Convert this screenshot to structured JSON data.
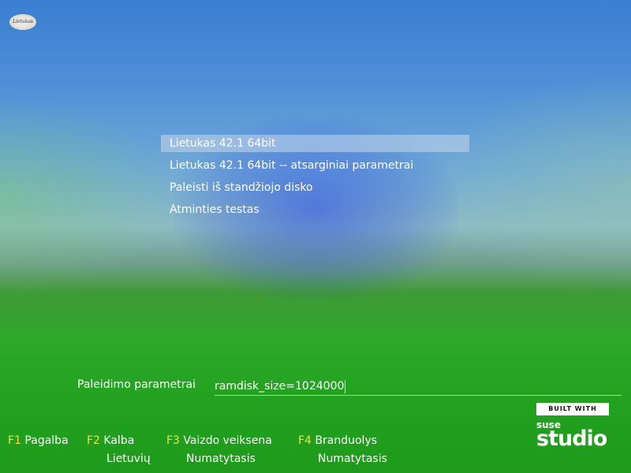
{
  "branding": {
    "logo_text": "Lietukas"
  },
  "menu": {
    "items": [
      {
        "label": "Lietukas 42.1 64bit",
        "selected": true
      },
      {
        "label": "Lietukas 42.1 64bit -- atsarginiai parametrai",
        "selected": false
      },
      {
        "label": "Paleisti iš standžiojo disko",
        "selected": false
      },
      {
        "label": "Atminties testas",
        "selected": false
      }
    ]
  },
  "boot_options": {
    "label": "Paleidimo parametrai",
    "value": "ramdisk_size=1024000"
  },
  "function_keys": [
    {
      "key": "F1",
      "label": "Pagalba",
      "value": ""
    },
    {
      "key": "F2",
      "label": "Kalba",
      "value": "Lietuvių"
    },
    {
      "key": "F3",
      "label": "Vaizdo veiksena",
      "value": "Numatytasis"
    },
    {
      "key": "F4",
      "label": "Branduolys",
      "value": "Numatytasis"
    }
  ],
  "studio_badge": {
    "built_with": "BUILT WITH",
    "suse": "suse",
    "studio": "studio"
  },
  "colors": {
    "fkey_accent": "#f0e040",
    "selection": "#c8d7eb"
  }
}
